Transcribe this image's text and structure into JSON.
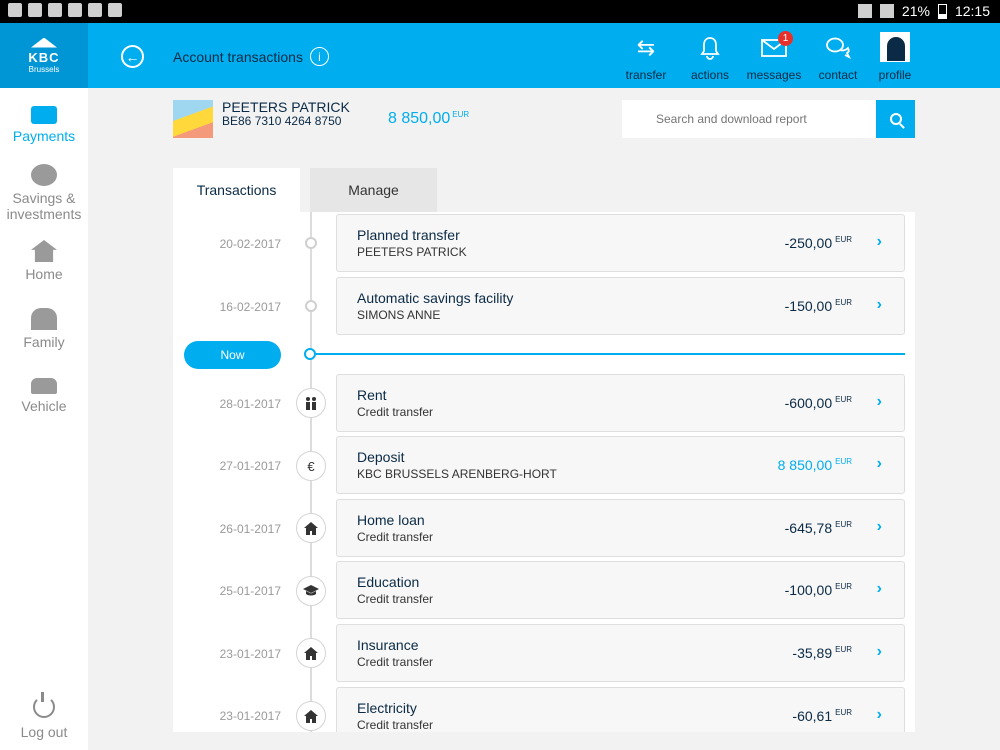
{
  "status": {
    "battery": "21%",
    "time": "12:15"
  },
  "header": {
    "logo_text": "KBC",
    "logo_city": "Brussels",
    "title": "Account transactions",
    "nav": [
      {
        "label": "transfer",
        "icon": "transfer-icon"
      },
      {
        "label": "actions",
        "icon": "bell-icon"
      },
      {
        "label": "messages",
        "icon": "mail-icon",
        "badge": "1"
      },
      {
        "label": "contact",
        "icon": "chat-icon"
      }
    ],
    "profile_label": "profile"
  },
  "sidebar": {
    "items": [
      {
        "label": "Payments",
        "icon": "wallet-icon",
        "active": true
      },
      {
        "label": "Savings & investments",
        "icon": "piggy-bank-icon"
      },
      {
        "label": "Home",
        "icon": "home-icon"
      },
      {
        "label": "Family",
        "icon": "family-icon"
      },
      {
        "label": "Vehicle",
        "icon": "car-icon"
      }
    ],
    "logout_label": "Log out"
  },
  "account": {
    "name": "PEETERS PATRICK",
    "iban": "BE86 7310 4264 8750",
    "balance": "8 850,00",
    "currency": "EUR"
  },
  "search": {
    "placeholder": "Search and download report"
  },
  "tabs": {
    "transactions": "Transactions",
    "manage": "Manage"
  },
  "now_label": "Now",
  "planned": [
    {
      "date": "20-02-2017",
      "title": "Planned transfer",
      "sub": "PEETERS PATRICK",
      "amount": "-250,00",
      "currency": "EUR"
    },
    {
      "date": "16-02-2017",
      "title": "Automatic savings facility",
      "sub": "SIMONS ANNE",
      "amount": "-150,00",
      "currency": "EUR"
    }
  ],
  "transactions": [
    {
      "date": "28-01-2017",
      "title": "Rent",
      "sub": "Credit transfer",
      "amount": "-600,00",
      "currency": "EUR",
      "icon": "family-icon"
    },
    {
      "date": "27-01-2017",
      "title": "Deposit",
      "sub": "KBC BRUSSELS ARENBERG-HORT",
      "amount": "8 850,00",
      "currency": "EUR",
      "icon": "euro-icon",
      "positive": true
    },
    {
      "date": "26-01-2017",
      "title": "Home loan",
      "sub": "Credit transfer",
      "amount": "-645,78",
      "currency": "EUR",
      "icon": "home-icon"
    },
    {
      "date": "25-01-2017",
      "title": "Education",
      "sub": "Credit transfer",
      "amount": "-100,00",
      "currency": "EUR",
      "icon": "graduation-cap-icon"
    },
    {
      "date": "23-01-2017",
      "title": "Insurance",
      "sub": "Credit transfer",
      "amount": "-35,89",
      "currency": "EUR",
      "icon": "home-icon"
    },
    {
      "date": "23-01-2017",
      "title": "Electricity",
      "sub": "Credit transfer",
      "amount": "-60,61",
      "currency": "EUR",
      "icon": "home-icon"
    }
  ]
}
